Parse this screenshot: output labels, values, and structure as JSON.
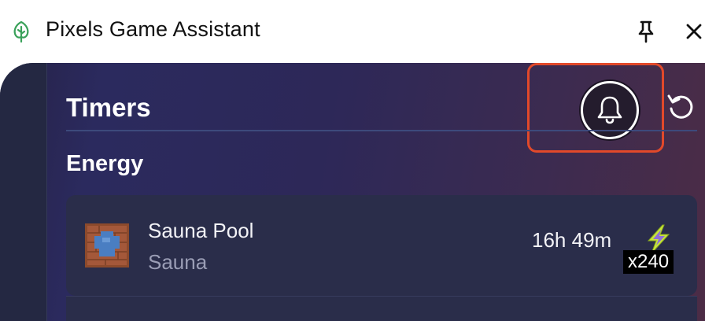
{
  "window": {
    "title": "Pixels Game Assistant",
    "icon": "tree-icon",
    "pin_icon": "pin-icon",
    "close_icon": "close-icon"
  },
  "header": {
    "title": "Timers",
    "notification_icon": "bell-icon",
    "reset_icon": "refresh-icon"
  },
  "section": {
    "title": "Energy"
  },
  "timers": [
    {
      "name": "Sauna Pool",
      "location": "Sauna",
      "remaining": "16h 49m",
      "reward_icon": "energy-bolt-icon",
      "reward_qty": "x240"
    }
  ],
  "colors": {
    "highlight": "#e2492a",
    "brand_green": "#3aa15a"
  }
}
